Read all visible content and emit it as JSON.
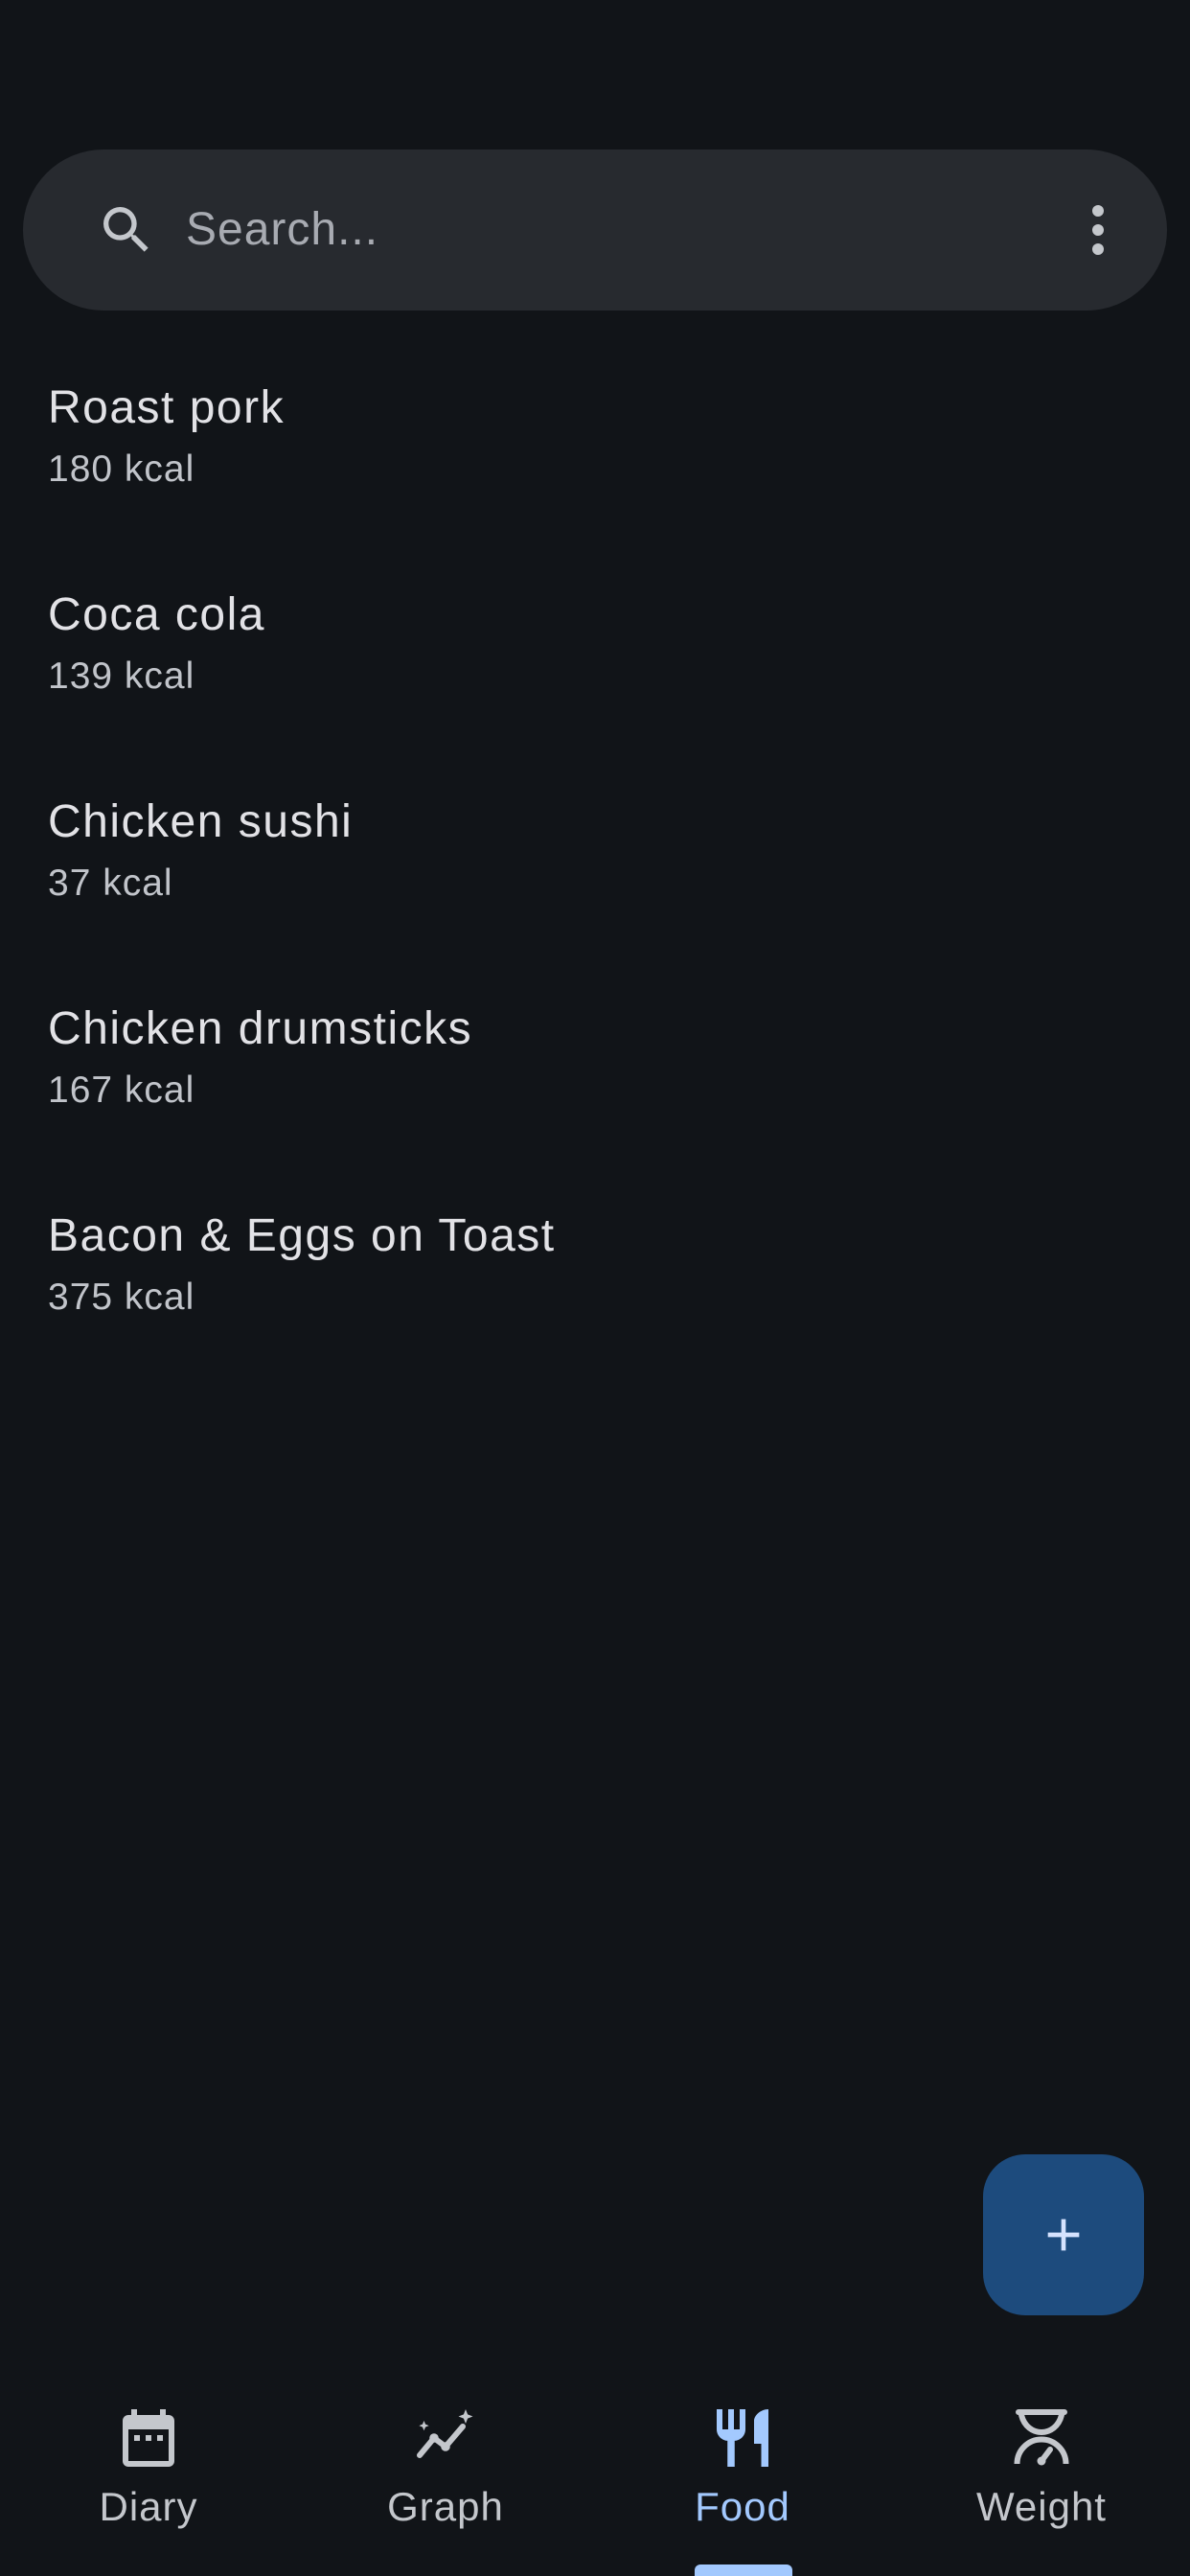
{
  "search": {
    "placeholder": "Search..."
  },
  "food_items": [
    {
      "name": "Roast pork",
      "kcal": "180 kcal"
    },
    {
      "name": "Coca cola",
      "kcal": "139 kcal"
    },
    {
      "name": "Chicken sushi",
      "kcal": "37 kcal"
    },
    {
      "name": "Chicken drumsticks",
      "kcal": "167 kcal"
    },
    {
      "name": "Bacon & Eggs on Toast",
      "kcal": "375 kcal"
    }
  ],
  "fab": {
    "icon": "plus-icon"
  },
  "nav": {
    "items": [
      {
        "label": "Diary",
        "icon": "calendar-icon",
        "active": false
      },
      {
        "label": "Graph",
        "icon": "graph-icon",
        "active": false
      },
      {
        "label": "Food",
        "icon": "cutlery-icon",
        "active": true
      },
      {
        "label": "Weight",
        "icon": "scale-icon",
        "active": false
      }
    ]
  },
  "colors": {
    "background": "#111418",
    "search_bg": "#272a2f",
    "accent": "#a3c9fe",
    "fab_bg": "#1d4b7d",
    "text_primary": "#e2e2e6",
    "text_secondary": "#c1c4ca"
  }
}
